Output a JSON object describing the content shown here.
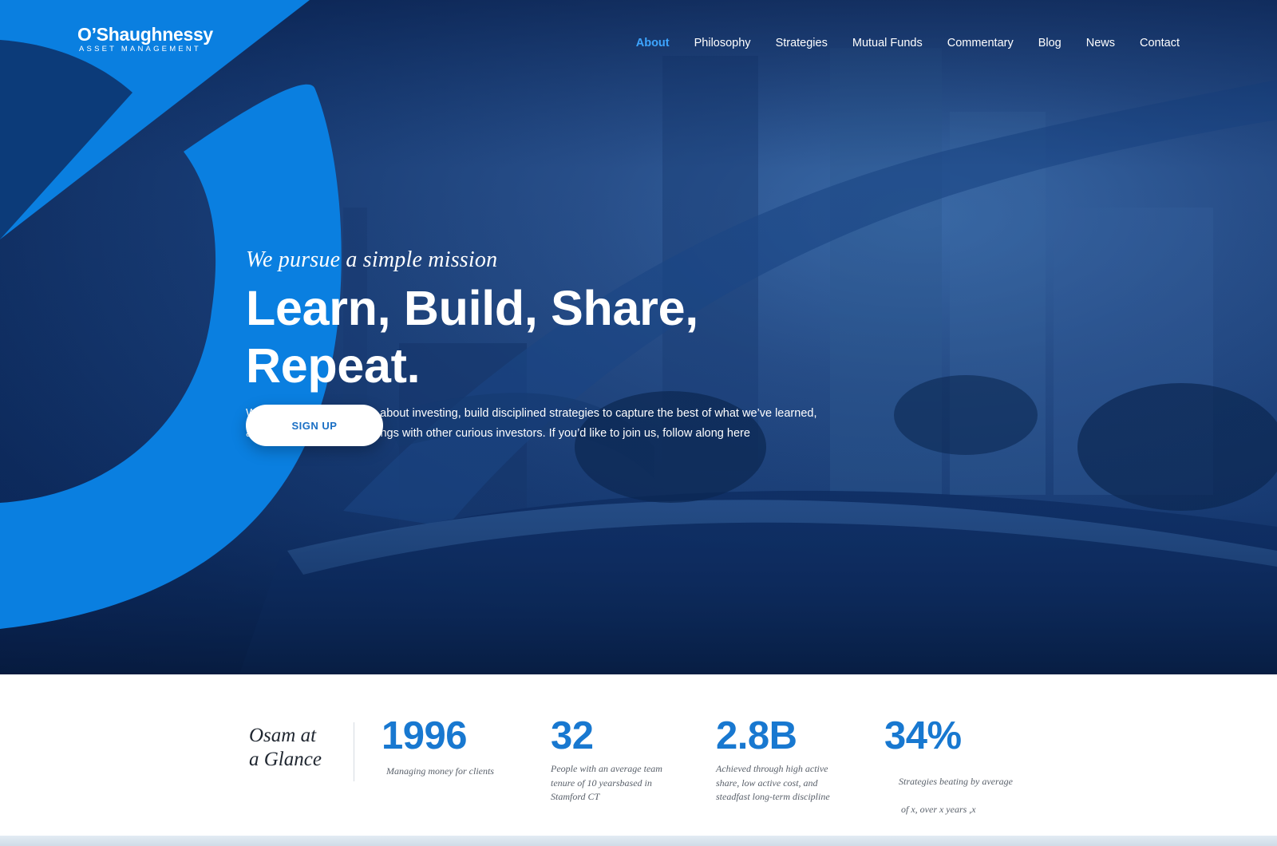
{
  "brand": {
    "name": "O’Shaughnessy",
    "subtitle": "ASSET MANAGEMENT"
  },
  "nav": {
    "items": [
      {
        "label": "About",
        "active": true
      },
      {
        "label": "Philosophy",
        "active": false
      },
      {
        "label": "Strategies",
        "active": false
      },
      {
        "label": "Mutual Funds",
        "active": false
      },
      {
        "label": "Commentary",
        "active": false
      },
      {
        "label": "Blog",
        "active": false
      },
      {
        "label": "News",
        "active": false
      },
      {
        "label": "Contact",
        "active": false
      }
    ]
  },
  "hero": {
    "kicker": "We pursue a simple mission",
    "headline": "Learn, Build, Share, Repeat.",
    "lede_line1": "We constantly learn more about investing, build disciplined strategies to capture the best of what we’ve learned,",
    "lede_line2": "and shares our broad findings with other curious investors. If you’d like to join us, follow along here",
    "cta_label": "SIGN UP"
  },
  "glance": {
    "title_line1": "Osam at",
    "title_line2": "a Glance",
    "stats": [
      {
        "value": "1996",
        "desc": [
          "Managing money for clients"
        ]
      },
      {
        "value": "32",
        "desc": [
          "People with an average team",
          "tenure of 10 yearsbased in",
          "Stamford CT"
        ]
      },
      {
        "value": "2.8B",
        "desc": [
          "Achieved through high active",
          "share, low active cost, and",
          "steadfast long-term discipline"
        ]
      },
      {
        "value": "34%",
        "desc": [
          "Strategies beating by average",
          " of x, over x years ,x"
        ]
      }
    ]
  },
  "colors": {
    "accent": "#1878d0",
    "nav_active": "#3da5ff",
    "arc_blue": "#0a7fe0",
    "hero_dark": "#0a2252"
  }
}
